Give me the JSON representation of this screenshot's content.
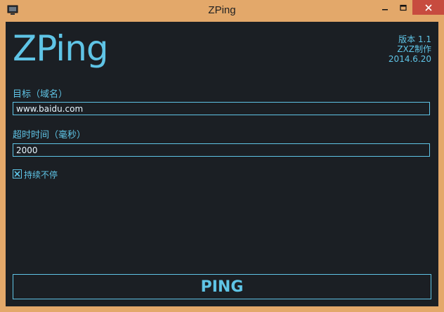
{
  "window": {
    "title": "ZPing",
    "icon": "app-icon",
    "controls": {
      "minimize": "minimize-icon",
      "maximize": "maximize-icon",
      "close": "close-icon"
    }
  },
  "header": {
    "brand": "ZPing",
    "version_line": "版本 1.1",
    "author_line": "ZXZ制作",
    "date_line": "2014.6.20"
  },
  "form": {
    "target_label": "目标（域名）",
    "target_value": "www.baidu.com",
    "timeout_label": "超时时间（毫秒）",
    "timeout_value": "2000",
    "continuous_label": "持续不停",
    "continuous_checked": true
  },
  "actions": {
    "ping_label": "PING"
  },
  "colors": {
    "accent": "#5fc4e6",
    "background": "#1b1f24",
    "frame": "#e3a86a",
    "close": "#c74b3f"
  }
}
